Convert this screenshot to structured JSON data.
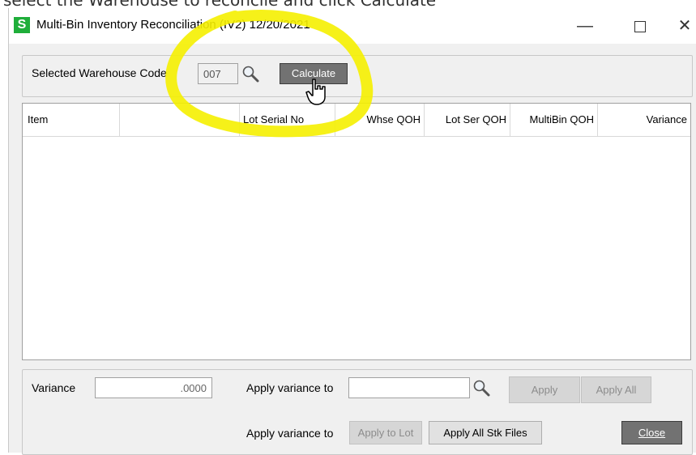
{
  "caption": "select the Warehouse to reconcile and click Calculate",
  "window": {
    "title": "Multi-Bin Inventory Reconciliation (IV2) 12/20/2021",
    "app_icon": "S",
    "controls": {
      "minimize": "—",
      "close": "✕"
    }
  },
  "warehouse": {
    "label": "Selected Warehouse Code",
    "value": "007",
    "lookup_icon": "magnifier-icon",
    "calculate_label": "Calculate"
  },
  "grid": {
    "columns": [
      "Item",
      "",
      "Lot Serial No",
      "Whse QOH",
      "Lot Ser QOH",
      "MultiBin QOH",
      "Variance"
    ],
    "rows": []
  },
  "footer": {
    "variance_label": "Variance",
    "variance_value": ".0000",
    "apply_variance_label": "Apply variance to",
    "apply_variance_value": "",
    "apply_label": "Apply",
    "apply_all_label": "Apply All",
    "apply_variance_label_2": "Apply variance to",
    "apply_to_lot_label": "Apply to Lot",
    "apply_all_stk_label": "Apply All Stk Files",
    "close_label": "Close"
  },
  "colors": {
    "highlight": "#f5f000",
    "app_icon": "#1fae3a",
    "dark_button": "#727272"
  }
}
